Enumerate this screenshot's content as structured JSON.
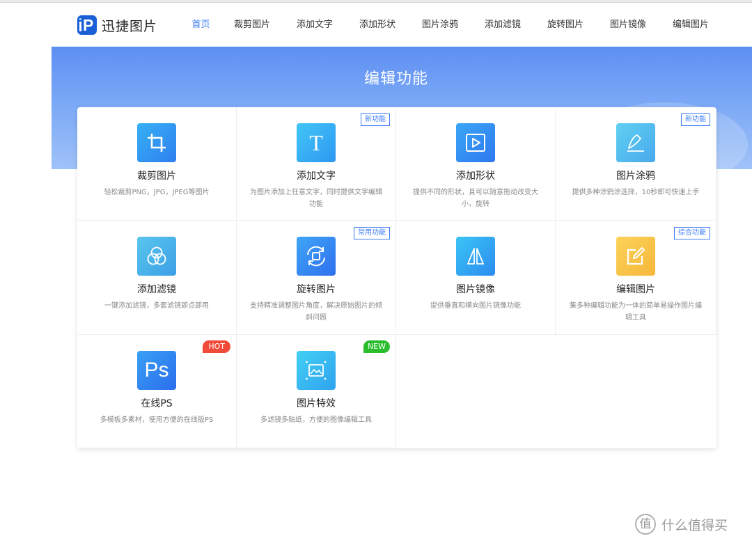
{
  "app": {
    "name": "迅捷图片"
  },
  "nav": {
    "items": [
      "首页",
      "裁剪图片",
      "添加文字",
      "添加形状",
      "图片涂鸦",
      "添加滤镜",
      "旋转图片",
      "图片镜像",
      "编辑图片"
    ],
    "active": "首页"
  },
  "banner": {
    "title": "编辑功能"
  },
  "colors": {
    "accent": "#3d7bf5",
    "banner": "#6f9ef5",
    "hot": "#ef4a3a",
    "new": "#2bbd2e"
  },
  "features": [
    {
      "title": "裁剪图片",
      "desc": "轻松裁剪PNG，JPG，JPEG等图片",
      "icon": "crop-icon"
    },
    {
      "title": "添加文字",
      "desc": "为图片添加上任意文字，同时提供文字编辑功能",
      "icon": "text-icon",
      "badge": "新功能"
    },
    {
      "title": "添加形状",
      "desc": "提供不同的形状，且可以随意拖动改变大小，旋转",
      "icon": "shape-icon"
    },
    {
      "title": "图片涂鸦",
      "desc": "提供多种涂鸦涂选择，10秒即可快速上手",
      "icon": "doodle-icon",
      "badge": "新功能"
    },
    {
      "title": "添加滤镜",
      "desc": "一键添加滤镜，多套滤镜即点即用",
      "icon": "filter-icon"
    },
    {
      "title": "旋转图片",
      "desc": "支持精准调整图片角度，解决原始图片的倾斜问题",
      "icon": "rotate-icon",
      "badge": "常用功能"
    },
    {
      "title": "图片镜像",
      "desc": "提供垂直和横向图片镜像功能",
      "icon": "mirror-icon"
    },
    {
      "title": "编辑图片",
      "desc": "集多种编辑功能为一体的简单易操作图片编辑工具",
      "icon": "edit-icon",
      "badge": "综合功能"
    },
    {
      "title": "在线PS",
      "desc": "多模板多素材，使用方便的在线版PS",
      "icon": "ps-icon",
      "badge": "HOT",
      "icon_text": "Ps"
    },
    {
      "title": "图片特效",
      "desc": "多滤镜多贴纸，方便的图像编辑工具",
      "icon": "effects-icon",
      "badge": "NEW"
    }
  ],
  "watermark": {
    "symbol": "值",
    "text": "什么值得买"
  }
}
